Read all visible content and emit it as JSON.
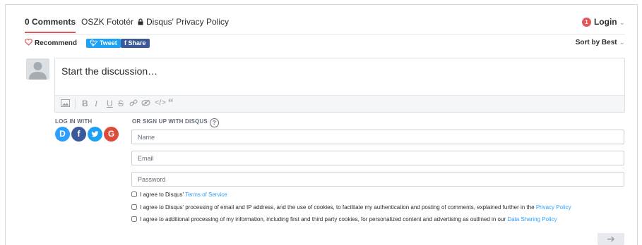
{
  "nav": {
    "comments_tab": "0 Comments",
    "site_tab": "OSZK Fototér",
    "privacy_tab": "Disqus' Privacy Policy",
    "login_badge": "1",
    "login_label": "Login"
  },
  "actions": {
    "recommend": "Recommend",
    "tweet": "Tweet",
    "share": "Share",
    "sort_by": "Sort by Best"
  },
  "compose": {
    "placeholder": "Start the discussion…"
  },
  "toolbar": {
    "icons": [
      "image-icon",
      "bold-icon",
      "italic-icon",
      "underline-icon",
      "strikethrough-icon",
      "link-icon",
      "spoiler-icon",
      "code-icon",
      "quote-icon"
    ]
  },
  "login_with": {
    "label": "LOG IN WITH",
    "providers": [
      {
        "name": "disqus",
        "glyph": "D",
        "color": "#2e9fff"
      },
      {
        "name": "facebook",
        "glyph": "f",
        "color": "#3b5998"
      },
      {
        "name": "twitter",
        "glyph": "",
        "color": "#1da1f2"
      },
      {
        "name": "google",
        "glyph": "G",
        "color": "#dd4b39"
      }
    ]
  },
  "signup": {
    "label": "OR SIGN UP WITH DISQUS",
    "help": "?",
    "name_placeholder": "Name",
    "email_placeholder": "Email",
    "password_placeholder": "Password"
  },
  "agreements": {
    "tos_prefix": "I agree to Disqus'",
    "tos_link": "Terms of Service",
    "processing_text": "I agree to Disqus' processing of email and IP address, and the use of cookies, to facilitate my authentication and posting of comments, explained further in the",
    "processing_link": "Privacy Policy",
    "additional_text": "I agree to additional processing of my information, including first and third party cookies, for personalized content and advertising as outlined in our",
    "additional_link": "Data Sharing Policy"
  },
  "submit": {
    "arrow": "➔"
  },
  "colors": {
    "accent_red": "#e0565a",
    "link_blue": "#2e9fff",
    "twitter_blue": "#1da1f2",
    "facebook_blue": "#3b5998"
  }
}
